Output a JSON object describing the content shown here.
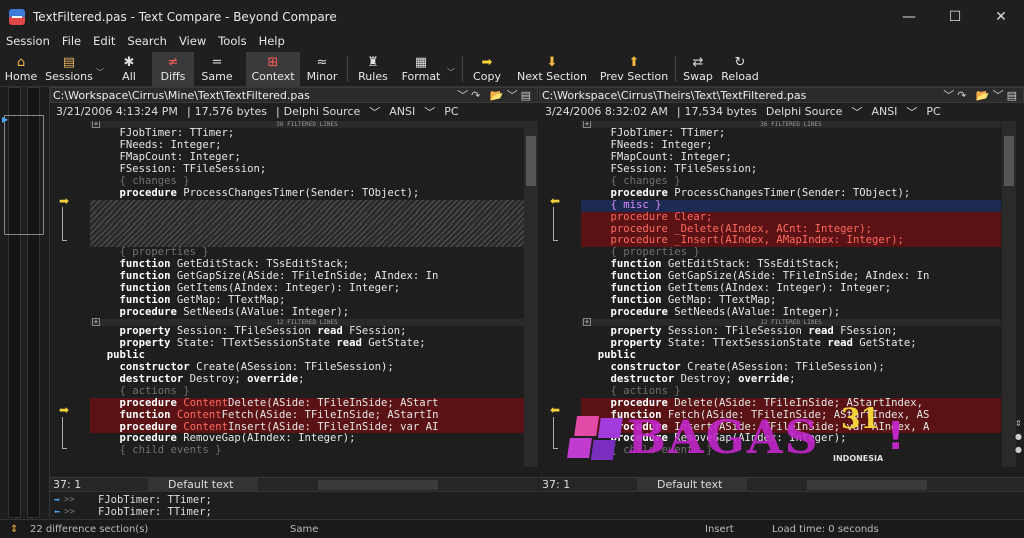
{
  "window": {
    "title": "TextFiltered.pas - Text Compare - Beyond Compare"
  },
  "menu": [
    "Session",
    "File",
    "Edit",
    "Search",
    "View",
    "Tools",
    "Help"
  ],
  "toolbar": [
    {
      "label": "Home",
      "icon": "home-icon",
      "glyph": "⌂"
    },
    {
      "label": "Sessions",
      "icon": "sessions-icon",
      "glyph": "▤",
      "dropdown": true
    },
    {
      "label": "All",
      "icon": "all-icon",
      "glyph": "✱"
    },
    {
      "label": "Diffs",
      "icon": "diffs-icon",
      "glyph": "≠",
      "selected": true
    },
    {
      "label": "Same",
      "icon": "same-icon",
      "glyph": "="
    },
    {
      "label": "Context",
      "icon": "context-icon",
      "glyph": "⊞",
      "selected": true
    },
    {
      "label": "Minor",
      "icon": "minor-icon",
      "glyph": "≈"
    },
    {
      "label": "Rules",
      "icon": "rules-icon",
      "glyph": "♜"
    },
    {
      "label": "Format",
      "icon": "format-icon",
      "glyph": "▦",
      "dropdown": true
    },
    {
      "label": "Copy",
      "icon": "copy-icon",
      "glyph": "➡"
    },
    {
      "label": "Next Section",
      "icon": "next-section-icon",
      "glyph": "⬇"
    },
    {
      "label": "Prev Section",
      "icon": "prev-section-icon",
      "glyph": "⬆"
    },
    {
      "label": "Swap",
      "icon": "swap-icon",
      "glyph": "⇄"
    },
    {
      "label": "Reload",
      "icon": "reload-icon",
      "glyph": "↻"
    }
  ],
  "left": {
    "path": "C:\\Workspace\\Cirrus\\Mine\\Text\\TextFiltered.pas",
    "date": "3/21/2006 4:13:24 PM",
    "size": "17,576 bytes",
    "format": "Delphi Source",
    "encoding": "ANSI",
    "lineend": "PC",
    "pos": "37: 1",
    "mode": "Default text"
  },
  "right": {
    "path": "C:\\Workspace\\Cirrus\\Theirs\\Text\\TextFiltered.pas",
    "date": "3/24/2006 8:32:02 AM",
    "size": "17,534 bytes",
    "format": "Delphi Source",
    "encoding": "ANSI",
    "lineend": "PC",
    "pos": "37: 1",
    "mode": "Default text"
  },
  "filtered1": "36 FILTERED LINES",
  "filtered2": "12 FILTERED LINES",
  "compare": {
    "line1": "FJobTimer: TTimer;",
    "line2": "FJobTimer: TTimer;"
  },
  "bottom": {
    "diffs": "22 difference section(s)",
    "same": "Same",
    "insert": "Insert",
    "load": "Load time: 0 seconds"
  },
  "watermark": {
    "brand": "BAGAS",
    "num": "31",
    "sub": "INDONESIA"
  }
}
